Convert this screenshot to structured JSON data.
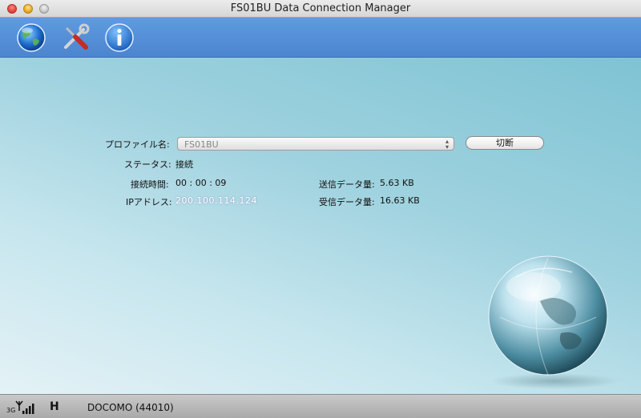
{
  "window": {
    "title": "FS01BU Data Connection Manager"
  },
  "toolbar": {
    "buttons": [
      {
        "icon": "globe-icon"
      },
      {
        "icon": "tools-icon"
      },
      {
        "icon": "info-icon"
      }
    ]
  },
  "form": {
    "profile_label": "プロファイル名:",
    "profile_value": "FS01BU",
    "disconnect_button": "切断",
    "status_label": "ステータス:",
    "status_value": "接続",
    "time_label": "接続時間:",
    "time_value": "00 : 00 : 09",
    "ip_label": "IPアドレス:",
    "ip_value": "200.100.114.124",
    "sent_label": "送信データ量:",
    "sent_value": "5.63 KB",
    "recv_label": "受信データ量:",
    "recv_value": "16.63 KB"
  },
  "statusbar": {
    "network_type": "3G",
    "hspa_indicator": "H",
    "carrier": "DOCOMO (44010)"
  },
  "colors": {
    "toolbar": "#5590d8",
    "content_bg": "#9fd2df",
    "statusbar": "#b8b8b8"
  }
}
